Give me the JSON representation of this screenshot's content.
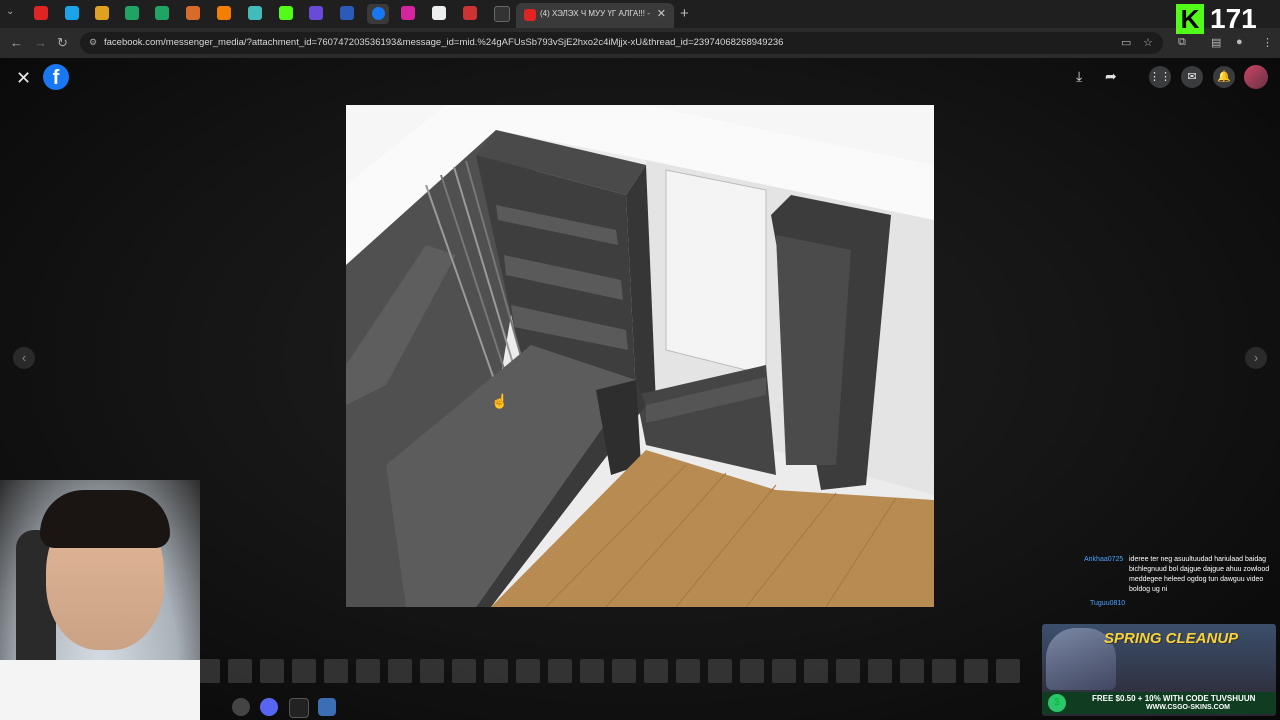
{
  "browser": {
    "active_tab_title": "(4) ХЭЛЭХ Ч МУУ ҮГ АЛГА!!! - ",
    "address": "facebook.com/messenger_media/?attachment_id=760747203536193&message_id=mid.%24gAFUsSb793vSjE2hxo2c4iMjjx-xU&thread_id=23974068268949236"
  },
  "kick_overlay": {
    "logo_letter": "K",
    "viewer_count": "171"
  },
  "viewer": {
    "brand_letter": "f",
    "cursor_glyph": "☝"
  },
  "chat": {
    "user1": "Ankhaa0725",
    "message1": "ideree ter neg asuultuudad hariulaad baidag bichlegnuud bol dajgue dajgue ahuu zowlood meddegee heleed ogdog tun dawguu video boldog ug ni",
    "user2": "Tuguu0810"
  },
  "ad": {
    "headline": "SPRING CLEANUP",
    "promo": "FREE $0.50 + 10% WITH CODE TUVSHUUN",
    "site": "WWW.CSGO-SKINS.COM"
  },
  "colors": {
    "tab_bar": "#1f1f1f",
    "address_bar": "#2b2b2b",
    "facebook_blue": "#1877f2",
    "kick_green": "#53fc18",
    "viewer_bg": "#141414",
    "ad_yellow": "#f7d23a"
  }
}
